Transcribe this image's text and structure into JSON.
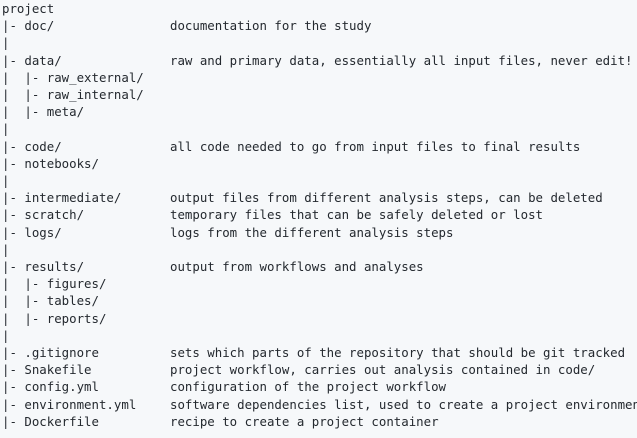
{
  "lines": [
    {
      "path": "project",
      "desc": ""
    },
    {
      "path": "|- doc/",
      "desc": "documentation for the study"
    },
    {
      "path": "|",
      "desc": ""
    },
    {
      "path": "|- data/",
      "desc": "raw and primary data, essentially all input files, never edit!"
    },
    {
      "path": "|  |- raw_external/",
      "desc": ""
    },
    {
      "path": "|  |- raw_internal/",
      "desc": ""
    },
    {
      "path": "|  |- meta/",
      "desc": ""
    },
    {
      "path": "|",
      "desc": ""
    },
    {
      "path": "|- code/",
      "desc": "all code needed to go from input files to final results"
    },
    {
      "path": "|- notebooks/",
      "desc": ""
    },
    {
      "path": "|",
      "desc": ""
    },
    {
      "path": "|- intermediate/",
      "desc": "output files from different analysis steps, can be deleted"
    },
    {
      "path": "|- scratch/",
      "desc": "temporary files that can be safely deleted or lost"
    },
    {
      "path": "|- logs/",
      "desc": "logs from the different analysis steps"
    },
    {
      "path": "|",
      "desc": ""
    },
    {
      "path": "|- results/",
      "desc": "output from workflows and analyses"
    },
    {
      "path": "|  |- figures/",
      "desc": ""
    },
    {
      "path": "|  |- tables/",
      "desc": ""
    },
    {
      "path": "|  |- reports/",
      "desc": ""
    },
    {
      "path": "|",
      "desc": ""
    },
    {
      "path": "|- .gitignore",
      "desc": "sets which parts of the repository that should be git tracked"
    },
    {
      "path": "|- Snakefile",
      "desc": "project workflow, carries out analysis contained in code/"
    },
    {
      "path": "|- config.yml",
      "desc": "configuration of the project workflow"
    },
    {
      "path": "|- environment.yml",
      "desc": "software dependencies list, used to create a project environment"
    },
    {
      "path": "|- Dockerfile",
      "desc": "recipe to create a project container"
    }
  ]
}
